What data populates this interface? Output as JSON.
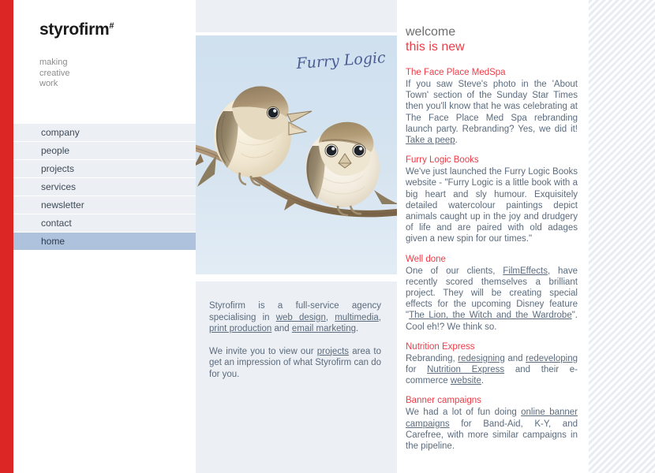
{
  "brand": {
    "name": "styrofirm",
    "mark": "#",
    "tagline": [
      "making",
      "creative",
      "work"
    ]
  },
  "colors": {
    "red_stripe": "#dc2626",
    "accent_red": "#ef3b46",
    "nav_bg": "#eceff4",
    "nav_active_bg": "#aec2de",
    "body_text": "#5b6b7d",
    "heading_grey": "#6e6e6e"
  },
  "nav": {
    "items": [
      {
        "label": "company",
        "active": false
      },
      {
        "label": "people",
        "active": false
      },
      {
        "label": "projects",
        "active": false
      },
      {
        "label": "services",
        "active": false
      },
      {
        "label": "newsletter",
        "active": false
      },
      {
        "label": "contact",
        "active": false
      },
      {
        "label": "home",
        "active": true
      }
    ]
  },
  "figure": {
    "caption": "Furry Logic",
    "alt": "Watercolour illustration of two small fluffy birds perched on a branch"
  },
  "intro": {
    "paragraph1_pre": "Styrofirm is a full-service agency specialising in ",
    "link_web_design": "web design",
    "sep1": ", ",
    "link_multimedia": "multimedia",
    "sep2": ", ",
    "link_print": "print production",
    "sep3": " and ",
    "link_email": "email marketing",
    "paragraph1_post": ".",
    "paragraph2_pre": "We invite you to view our ",
    "link_projects": "projects",
    "paragraph2_post": " area to get an impression of what Styrofirm can do for you."
  },
  "welcome": {
    "title": "welcome",
    "subtitle": "this is new"
  },
  "news": [
    {
      "title": "The Face Place MedSpa",
      "body_pre": "If you saw Steve's photo in the 'About Town' section of the Sunday Star Times then you'll know that he was celebrating at The Face Place Med Spa rebranding launch party. Rebranding? Yes, we did it! ",
      "link": "Take a peep",
      "body_post": "."
    },
    {
      "title": "Furry Logic Books",
      "body_pre": "We've just launched the Furry Logic Books website - \"Furry Logic is a little book with a big heart and sly humour. Exquisitely detailed watercolour paintings depict animals caught up in the joy and drudgery of life and are paired with old adages given a new spin for our times.\"",
      "link": "",
      "body_post": ""
    },
    {
      "title": "Well done",
      "body_pre": "One of our clients, ",
      "link": "FilmEffects",
      "body_mid": ", have recently scored themselves a brilliant project. They will be creating special effects for the upcoming Disney feature \"",
      "link2": "The Lion, the Witch and the Wardrobe",
      "body_post": "\". Cool eh!? We think so."
    },
    {
      "title": "Nutrition Express",
      "body_pre": "Rebranding, ",
      "link": "redesigning",
      "body_mid": " and ",
      "link2": "redeveloping",
      "body_mid2": " for ",
      "link3": "Nutrition Express",
      "body_mid3": " and their e-commerce ",
      "link4": "website",
      "body_post": "."
    },
    {
      "title": "Banner campaigns",
      "body_pre": "We had a lot of fun doing ",
      "link": "online banner campaigns",
      "body_post": " for Band-Aid, K-Y, and Carefree, with more similar campaigns in the pipeline."
    }
  ]
}
